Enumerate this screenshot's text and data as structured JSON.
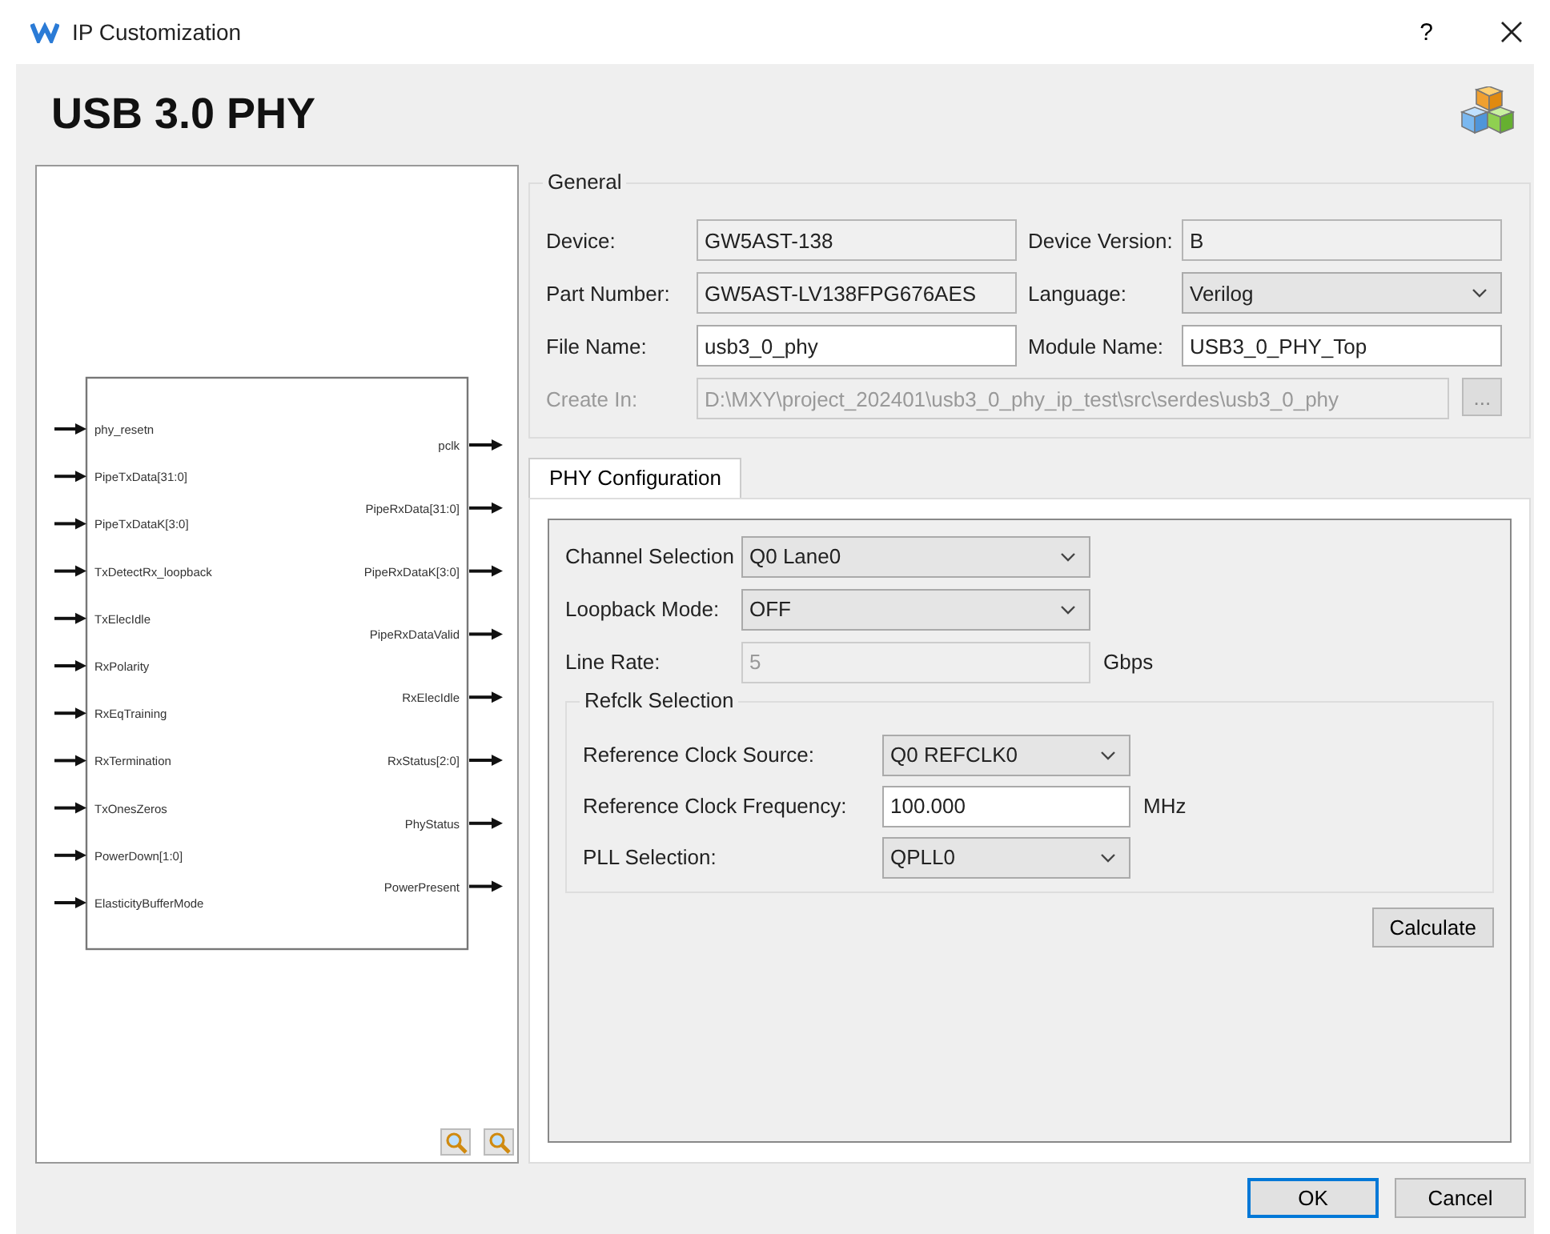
{
  "window": {
    "title": "IP Customization",
    "help": "?"
  },
  "header": {
    "title": "USB 3.0 PHY"
  },
  "diagram": {
    "inputs": [
      "phy_resetn",
      "PipeTxData[31:0]",
      "PipeTxDataK[3:0]",
      "TxDetectRx_loopback",
      "TxElecIdle",
      "RxPolarity",
      "RxEqTraining",
      "RxTermination",
      "TxOnesZeros",
      "PowerDown[1:0]",
      "ElasticityBufferMode"
    ],
    "outputs": [
      "pclk",
      "PipeRxData[31:0]",
      "PipeRxDataK[3:0]",
      "PipeRxDataValid",
      "RxElecIdle",
      "RxStatus[2:0]",
      "PhyStatus",
      "PowerPresent"
    ]
  },
  "general": {
    "legend": "General",
    "fields": [
      {
        "label": "Device:",
        "value": "GW5AST-138",
        "kind": "text",
        "readonly": true,
        "disabled": false
      },
      {
        "label": "Device Version:",
        "value": "B",
        "kind": "text",
        "readonly": true,
        "disabled": false
      },
      {
        "label": "Part Number:",
        "value": "GW5AST-LV138FPG676AES",
        "kind": "text",
        "readonly": true,
        "disabled": false
      },
      {
        "label": "Language:",
        "value": "Verilog",
        "kind": "select",
        "disabled": false
      },
      {
        "label": "File Name:",
        "value": "usb3_0_phy",
        "kind": "text",
        "readonly": false,
        "disabled": false
      },
      {
        "label": "Module Name:",
        "value": "USB3_0_PHY_Top",
        "kind": "text",
        "readonly": false,
        "disabled": false
      }
    ],
    "create_in": {
      "label": "Create In:",
      "value": "D:\\MXY\\project_202401\\usb3_0_phy_ip_test\\src\\serdes\\usb3_0_phy",
      "disabled": true,
      "browse": "..."
    }
  },
  "tabs": [
    {
      "label": "PHY Configuration",
      "selected": true
    }
  ],
  "phy": {
    "fields": [
      {
        "label": "Channel Selection",
        "value": "Q0 Lane0",
        "kind": "select",
        "disabled": false
      },
      {
        "label": "Loopback Mode:",
        "value": "OFF",
        "kind": "select",
        "disabled": false
      },
      {
        "label": "Line Rate:",
        "value": "5",
        "kind": "text",
        "disabled": true,
        "unit": "Gbps"
      }
    ],
    "refclk": {
      "legend": "Refclk Selection",
      "fields": [
        {
          "label": "Reference Clock Source:",
          "value": "Q0 REFCLK0",
          "kind": "select",
          "disabled": false
        },
        {
          "label": "Reference Clock Frequency:",
          "value": "100.000",
          "kind": "text",
          "disabled": false,
          "unit": "MHz"
        },
        {
          "label": "PLL Selection:",
          "value": "QPLL0",
          "kind": "select",
          "disabled": false
        }
      ]
    },
    "calculate": "Calculate"
  },
  "buttons": [
    {
      "label": "OK",
      "selected": true
    },
    {
      "label": "Cancel",
      "selected": false
    }
  ]
}
